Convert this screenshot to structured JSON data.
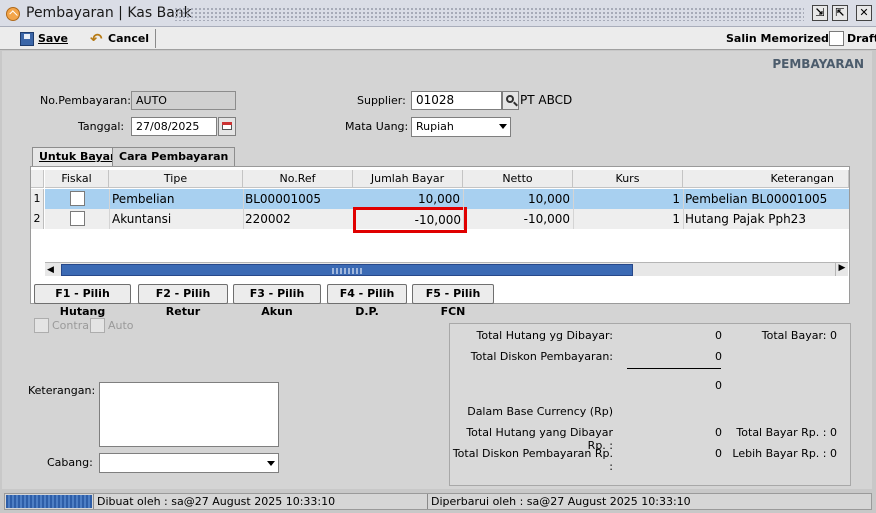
{
  "window": {
    "title": "Pembayaran | Kas Bank",
    "buttons": [
      "restore-icon",
      "maximize-icon",
      "close-icon"
    ]
  },
  "toolbar": {
    "save_label": "Save",
    "cancel_label": "Cancel",
    "salin_memorized_label": "Salin Memorized",
    "draft_label": "Draft"
  },
  "section_title": "PEMBAYARAN",
  "form": {
    "no_pembayaran_label": "No.Pembayaran:",
    "no_pembayaran_value": "AUTO",
    "tanggal_label": "Tanggal:",
    "tanggal_value": "27/08/2025",
    "supplier_label": "Supplier:",
    "supplier_value": "01028",
    "supplier_name": "PT ABCD",
    "mata_uang_label": "Mata Uang:",
    "mata_uang_value": "Rupiah"
  },
  "tabs": [
    {
      "label": "Untuk Bayar",
      "active": true
    },
    {
      "label": "Cara Pembayaran",
      "active": false
    }
  ],
  "grid": {
    "columns": [
      "Fiskal",
      "Tipe",
      "No.Ref",
      "Jumlah Bayar",
      "Netto",
      "Kurs",
      "Keterangan"
    ],
    "rows": [
      {
        "num": "1",
        "fiskal": false,
        "tipe": "Pembelian",
        "no_ref": "BL00001005",
        "jumlah_bayar": "10,000",
        "netto": "10,000",
        "kurs": "1",
        "keterangan": "Pembelian BL00001005"
      },
      {
        "num": "2",
        "fiskal": false,
        "tipe": "Akuntansi",
        "no_ref": "220002",
        "jumlah_bayar": "-10,000",
        "netto": "-10,000",
        "kurs": "1",
        "keterangan": "Hutang Pajak Pph23"
      }
    ]
  },
  "function_buttons": [
    "F1 - Pilih Hutang",
    "F2 - Pilih Retur",
    "F3 - Pilih Akun",
    "F4 - Pilih D.P.",
    "F5 - Pilih FCN"
  ],
  "options": {
    "contra_label": "Contra",
    "auto_label": "Auto"
  },
  "bottom_form": {
    "keterangan_label": "Keterangan:",
    "keterangan_value": "",
    "cabang_label": "Cabang:",
    "cabang_value": ""
  },
  "summary": {
    "total_hutang_label": "Total Hutang yg Dibayar:",
    "total_hutang_value": "0",
    "total_bayar_label": "Total Bayar:",
    "total_bayar_value": "0",
    "total_diskon_label": "Total Diskon Pembayaran:",
    "total_diskon_value": "0",
    "subtotal_value": "0",
    "base_currency_label": "Dalam Base Currency (Rp)",
    "total_hutang_rp_label": "Total Hutang yang Dibayar Rp. :",
    "total_hutang_rp_value": "0",
    "total_bayar_rp_label": "Total Bayar Rp. :",
    "total_bayar_rp_value": "0",
    "total_diskon_rp_label": "Total Diskon Pembayaran Rp. :",
    "total_diskon_rp_value": "0",
    "lebih_bayar_rp_label": "Lebih Bayar Rp. :",
    "lebih_bayar_rp_value": "0"
  },
  "status": {
    "dibuat": "Dibuat oleh : sa@27 August 2025  10:33:10",
    "diperbarui": "Diperbarui oleh : sa@27 August 2025  10:33:10"
  },
  "colors": {
    "selected_row": "#a8d0f0",
    "highlight_box": "#e00000",
    "scroll_thumb": "#3b6ab4"
  }
}
